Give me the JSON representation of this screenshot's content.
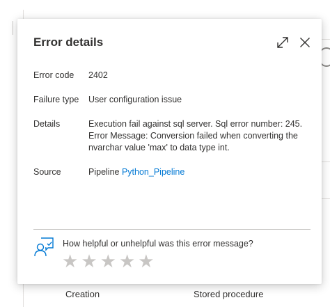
{
  "background": {
    "table_row": {
      "col1": "Creation",
      "col2": "Stored procedure"
    }
  },
  "dialog": {
    "title": "Error details",
    "fields": {
      "error_code": {
        "label": "Error code",
        "value": "2402"
      },
      "failure_type": {
        "label": "Failure type",
        "value": "User configuration issue"
      },
      "details": {
        "label": "Details",
        "value": "Execution fail against sql server. Sql error number: 245. Error Message: Conversion failed when converting the nvarchar value 'max' to data type int."
      },
      "source": {
        "label": "Source",
        "prefix": "Pipeline",
        "link": "Python_Pipeline"
      }
    },
    "feedback": {
      "question": "How helpful or unhelpful was this error message?",
      "rating_max": 5,
      "rating_value": 0
    },
    "icons": {
      "expand": "expand-icon",
      "close": "close-icon",
      "feedback": "feedback-person-icon",
      "star": "star-icon"
    },
    "colors": {
      "link": "#0078d4",
      "star_empty": "#c8c6c4",
      "text": "#323130"
    }
  }
}
